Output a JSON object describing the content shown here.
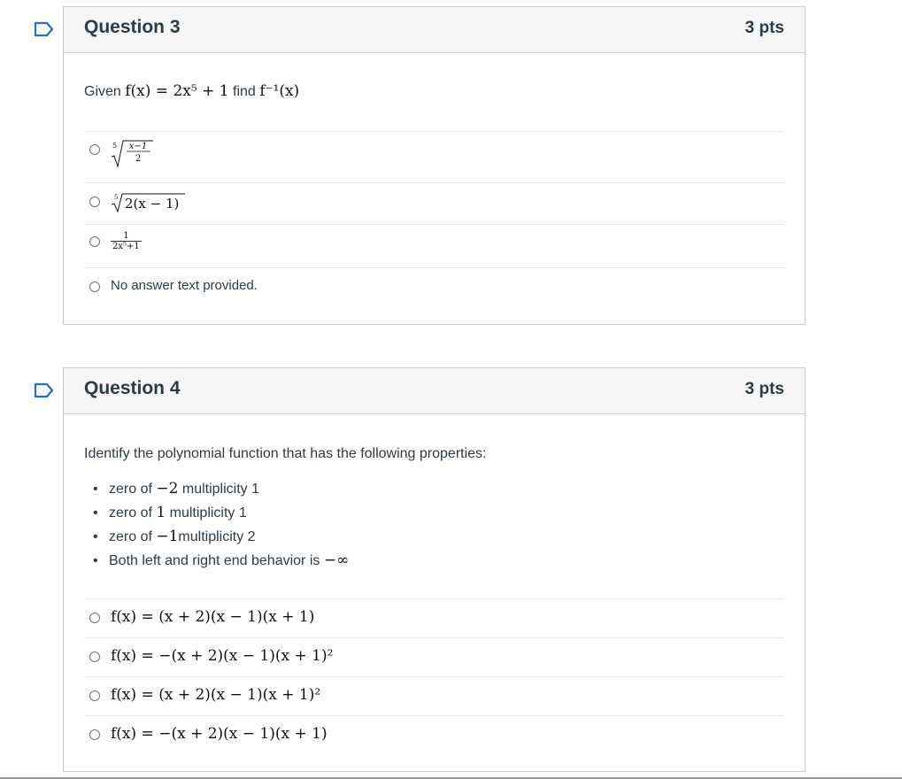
{
  "colors": {
    "flag": "#1f6ed4",
    "border": "#c7cdd1",
    "header_bg": "#f5f5f5",
    "text": "#2d3b45"
  },
  "q3": {
    "title": "Question 3",
    "points": "3 pts",
    "prompt_given": "Given",
    "prompt_func": "f(x) = 2x⁵ + 1",
    "prompt_find": "find",
    "prompt_inverse": "f⁻¹(x)",
    "answers": [
      {
        "index": "5",
        "num": "x−1",
        "den": "2"
      },
      {
        "text": "∛2(x − 1)",
        "index": "5",
        "radicand": "2(x − 1)"
      },
      {
        "num": "1",
        "den": "2x⁵+1"
      },
      {
        "text": "No answer text provided."
      }
    ]
  },
  "q4": {
    "title": "Question 4",
    "points": "3 pts",
    "prompt": "Identify the polynomial function that has the following properties:",
    "properties": [
      {
        "pre": "zero of ",
        "math": "−2",
        "post": " multiplicity 1"
      },
      {
        "pre": "zero of ",
        "math": "1",
        "post": " multiplicity  1"
      },
      {
        "pre": "zero of ",
        "math": "−1",
        "post": "multiplicity  2"
      },
      {
        "pre": "Both left and right end behavior is ",
        "math": "−∞",
        "post": ""
      }
    ],
    "answers": [
      {
        "text": "f(x) = (x + 2)(x − 1)(x + 1)"
      },
      {
        "text": "f(x) = −(x + 2)(x − 1)(x + 1)²"
      },
      {
        "text": "f(x) = (x + 2)(x − 1)(x + 1)²"
      },
      {
        "text": "f(x) = −(x + 2)(x − 1)(x + 1)"
      }
    ]
  }
}
